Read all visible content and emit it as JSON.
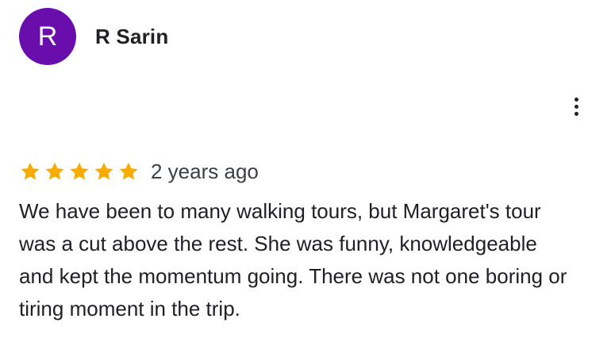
{
  "reviewer": {
    "name": "R Sarin",
    "initial": "R",
    "avatar_color": "#6A0DAD"
  },
  "review": {
    "rating": 5,
    "rating_max": 5,
    "star_color": "#F9AB00",
    "date": "2 years ago",
    "text": "We have been to many walking tours, but Margaret's tour was a cut above the rest. She was funny, knowledgeable and kept the momentum going. There was not one boring or tiring moment in the trip."
  },
  "actions": {
    "more_icon": "more-vert-icon"
  }
}
